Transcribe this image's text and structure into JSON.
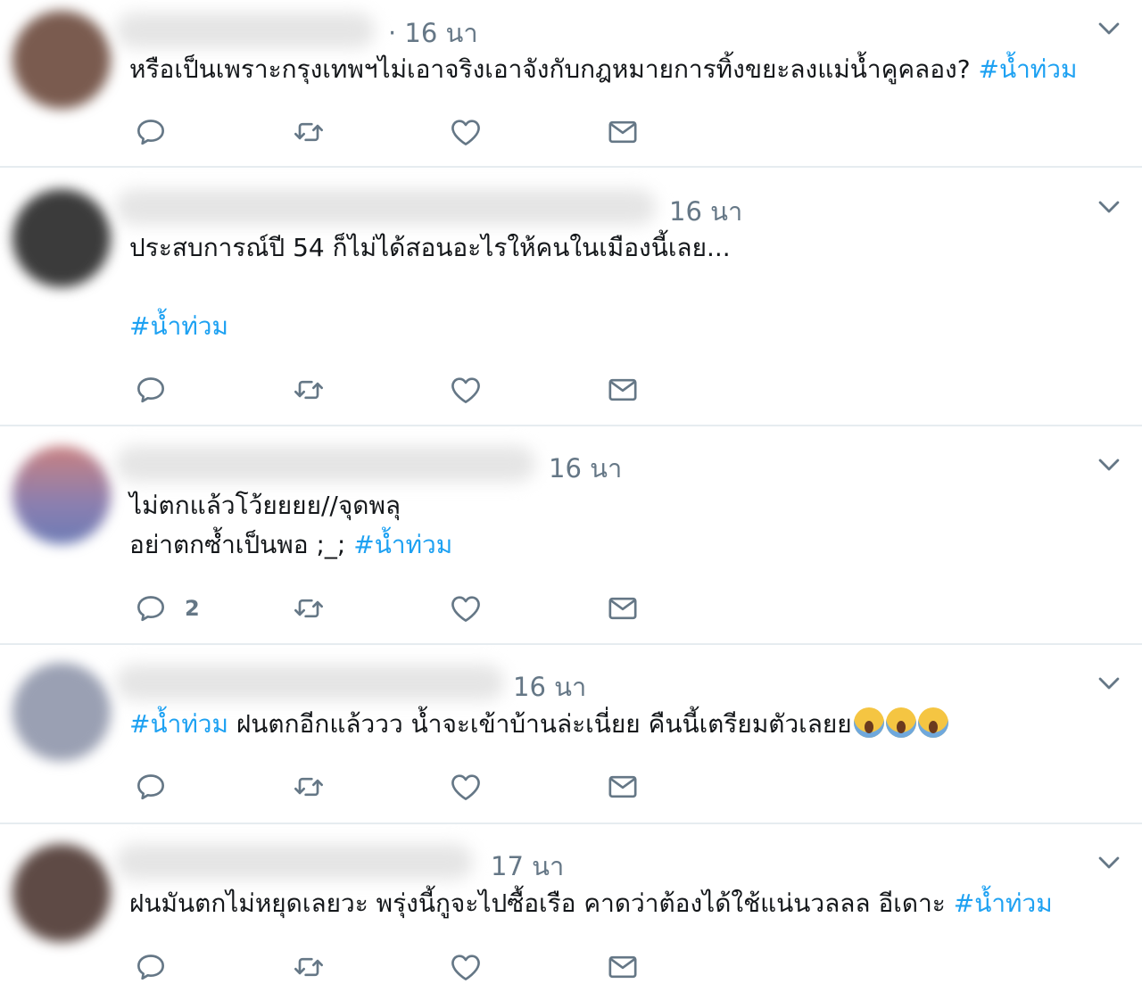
{
  "colors": {
    "hashtag": "#1da1f2",
    "meta": "#657786",
    "divider": "#e6ecf0",
    "text": "#14171a"
  },
  "tweets": [
    {
      "time": "· 16 นา",
      "text": "หรือเป็นเพราะกรุงเทพฯไม่เอาจริงเอาจังกับกฎหมายการทิ้งขยะลงแม่น้ำคูคลอง?",
      "hashtag": "#น้ำท่วม",
      "reply_count": ""
    },
    {
      "time": "16 นา",
      "text": "ประสบการณ์ปี 54 ก็ไม่ได้สอนอะไรให้คนในเมืองนี้เลย...",
      "hashtag": "#น้ำท่วม",
      "reply_count": ""
    },
    {
      "time": "16 นา",
      "text_line1": "ไม่ตกแล้วโว้ยยยย//จุดพลุ",
      "text_line2": "อย่าตกซ้ำเป็นพอ ;_;",
      "hashtag": "#น้ำท่วม",
      "reply_count": "2"
    },
    {
      "time": "16 นา",
      "hashtag": "#น้ำท่วม",
      "text": "ฝนตกอีกแล้ววว น้ำจะเข้าบ้านล่ะเนี่ยย คืนนี้เตรียมตัวเลยย",
      "emoji": "scream-emoji",
      "reply_count": ""
    },
    {
      "time": "17 นา",
      "text": "ฝนมันตกไม่หยุดเลยวะ พรุ่งนี้กูจะไปซื้อเรือ คาดว่าต้องได้ใช้แน่นวลลล อีเดาะ",
      "hashtag": "#น้ำท่วม",
      "reply_count": ""
    }
  ],
  "icons": {
    "reply": "reply-icon",
    "retweet": "retweet-icon",
    "like": "heart-icon",
    "message": "envelope-icon",
    "more": "chevron-down-icon"
  }
}
